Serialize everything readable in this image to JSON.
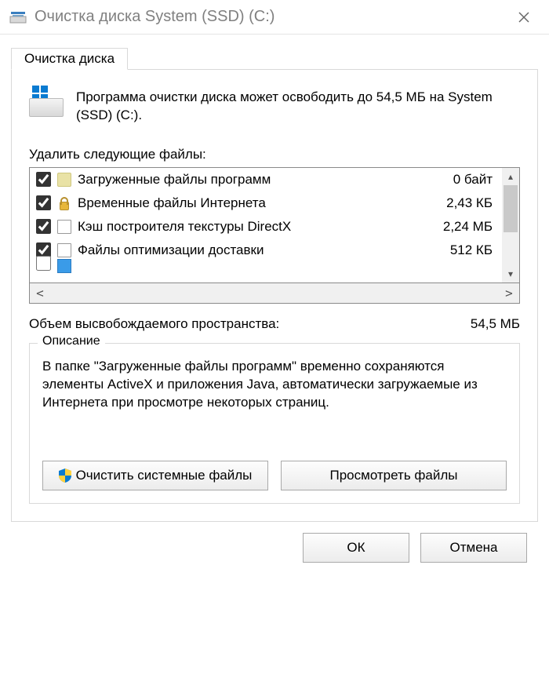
{
  "window": {
    "title": "Очистка диска System (SSD) (C:)"
  },
  "tab": {
    "label": "Очистка диска"
  },
  "intro": {
    "text": "Программа очистки диска может освободить до 54,5 МБ на System (SSD) (C:)."
  },
  "list": {
    "label": "Удалить следующие файлы:",
    "items": [
      {
        "checked": true,
        "icon": "folder",
        "name": "Загруженные файлы программ",
        "size": "0 байт"
      },
      {
        "checked": true,
        "icon": "lock",
        "name": "Временные файлы Интернета",
        "size": "2,43 КБ"
      },
      {
        "checked": true,
        "icon": "file",
        "name": "Кэш построителя текстуры DirectX",
        "size": "2,24 МБ"
      },
      {
        "checked": true,
        "icon": "file",
        "name": "Файлы оптимизации доставки",
        "size": "512 КБ"
      }
    ]
  },
  "total": {
    "label": "Объем высвобождаемого пространства:",
    "value": "54,5 МБ"
  },
  "description": {
    "legend": "Описание",
    "text": "В папке \"Загруженные файлы программ\" временно сохраняются элементы ActiveX и приложения Java, автоматически загружаемые из Интернета при просмотре некоторых страниц."
  },
  "buttons": {
    "clean_system": "Очистить системные файлы",
    "view_files": "Просмотреть файлы",
    "ok": "ОК",
    "cancel": "Отмена"
  }
}
